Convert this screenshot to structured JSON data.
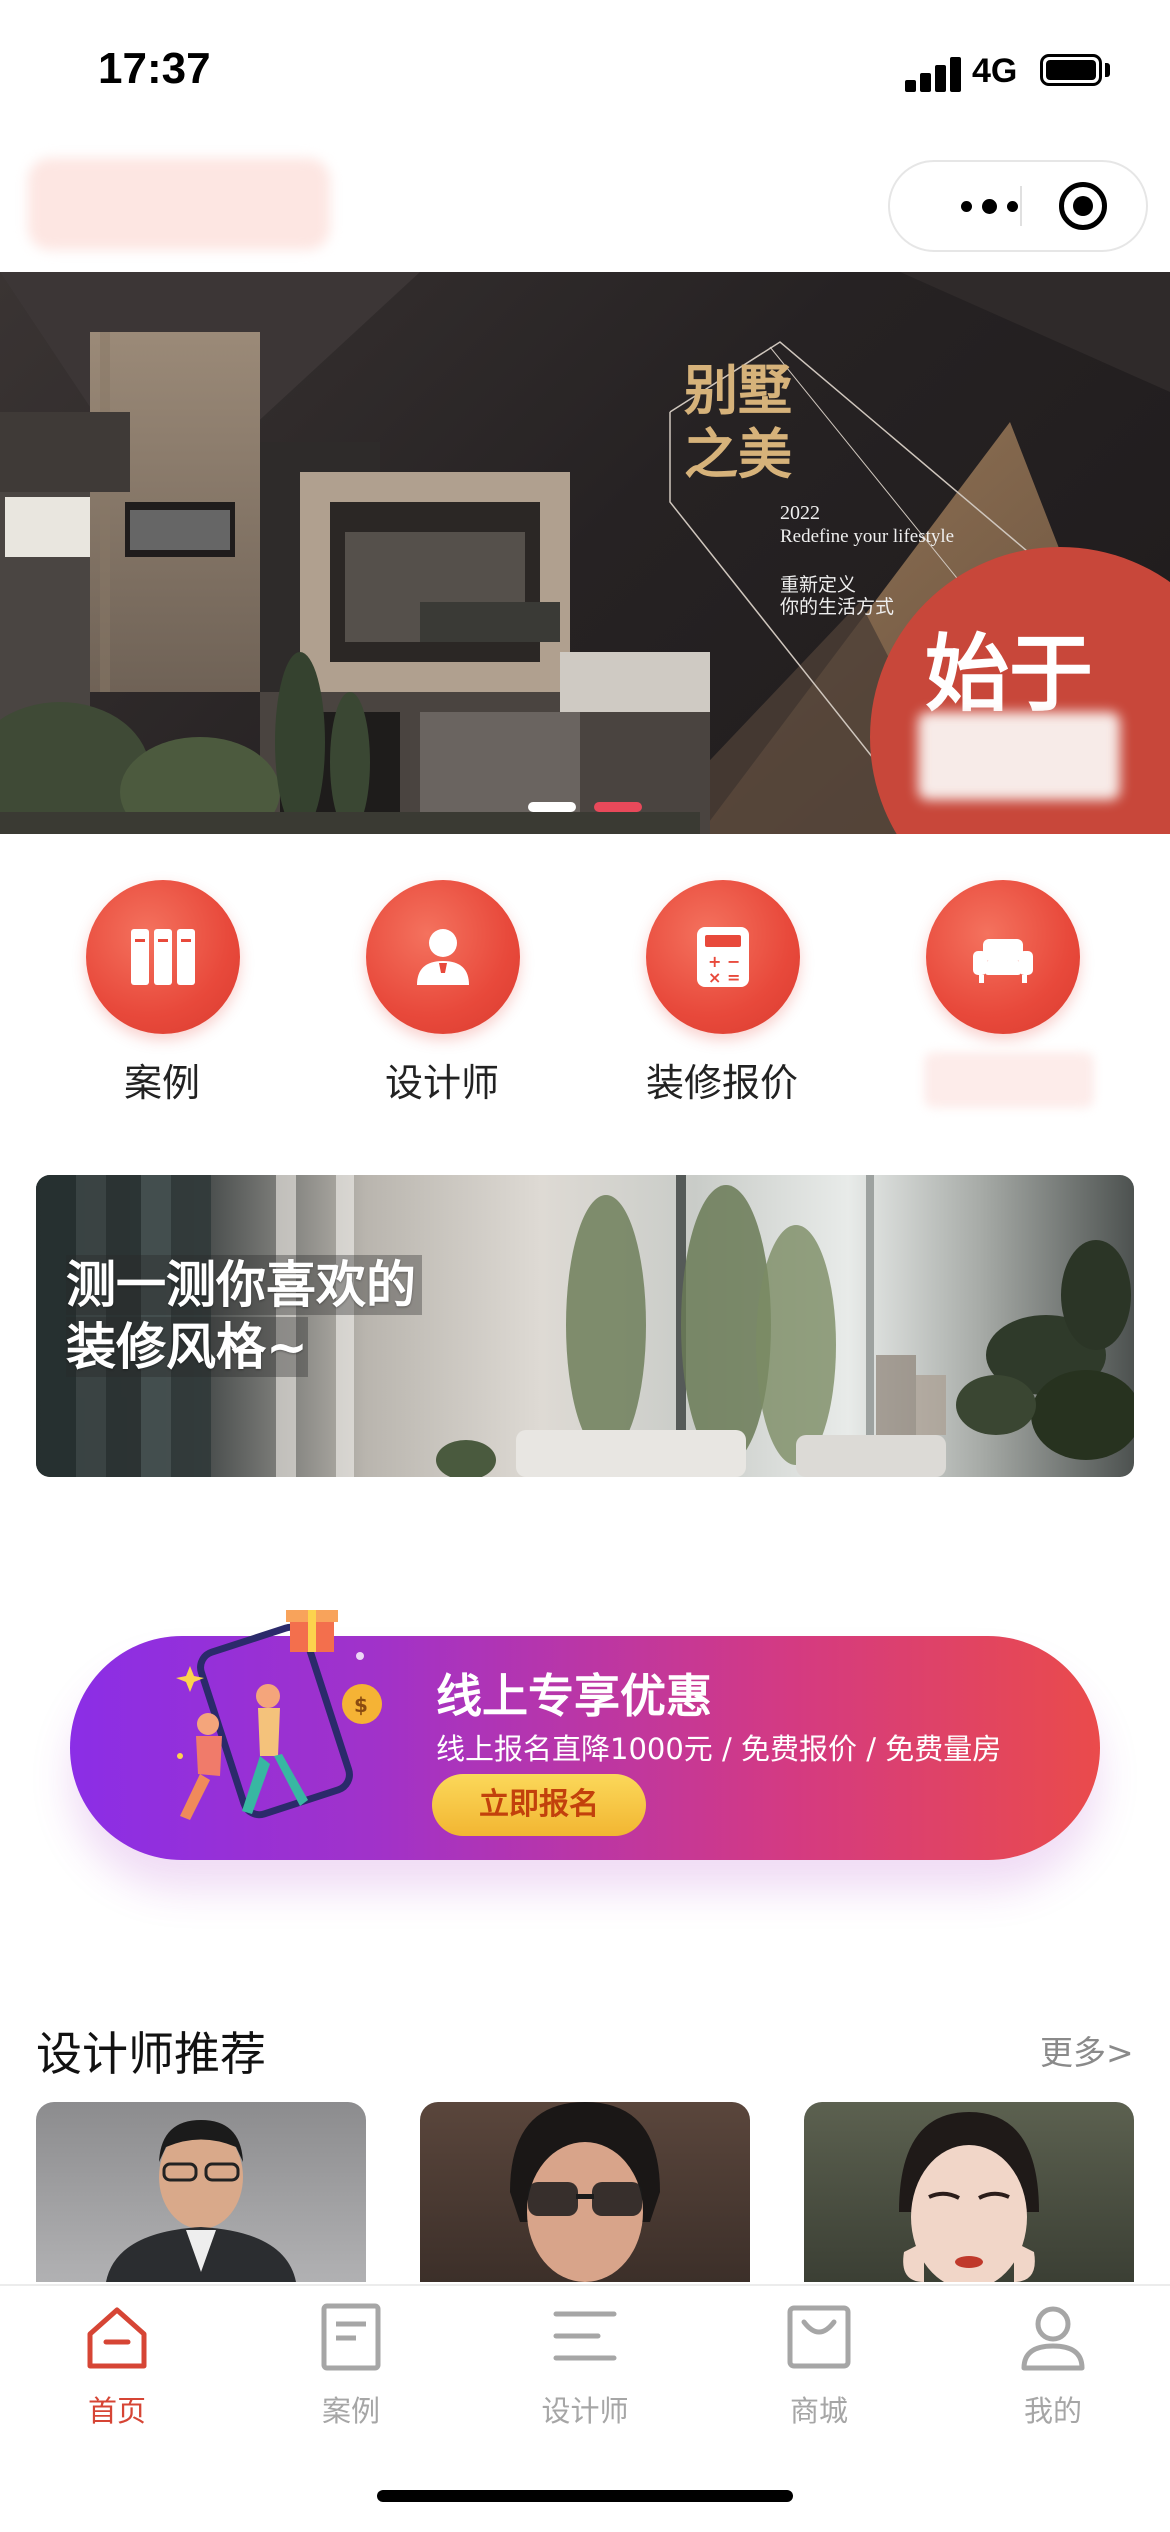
{
  "status_bar": {
    "time": "17:37",
    "network": "4G"
  },
  "hero": {
    "title": "别墅\n之美",
    "year": "2022",
    "slogan_en": "Redefine your lifestyle",
    "slogan_cn_1": "重新定义",
    "slogan_cn_2": "你的生活方式",
    "begin_text": "始于",
    "pager": {
      "count": 2,
      "active_index": 1
    }
  },
  "quick_nav": [
    {
      "label": "案例",
      "icon": "case-books-icon"
    },
    {
      "label": "设计师",
      "icon": "designer-person-icon"
    },
    {
      "label": "装修报价",
      "icon": "calculator-icon"
    },
    {
      "label": "",
      "icon": "sofa-icon"
    }
  ],
  "quiz_banner": {
    "line1": "测一测你喜欢的",
    "line2": "装修风格~"
  },
  "promo": {
    "title": "线上专享优惠",
    "subtitle": "线上报名直降1000元 / 免费报价 / 免费量房",
    "button": "立即报名"
  },
  "designers": {
    "title": "设计师推荐",
    "more": "更多>",
    "cards": [
      {
        "name": "designer-photo-1"
      },
      {
        "name": "designer-photo-2"
      },
      {
        "name": "designer-photo-3"
      }
    ]
  },
  "tabbar": [
    {
      "label": "首页",
      "icon": "home-icon",
      "active": true
    },
    {
      "label": "案例",
      "icon": "document-icon",
      "active": false
    },
    {
      "label": "设计师",
      "icon": "menu-lines-icon",
      "active": false
    },
    {
      "label": "商城",
      "icon": "shopping-bag-icon",
      "active": false
    },
    {
      "label": "我的",
      "icon": "user-icon",
      "active": false
    }
  ],
  "colors": {
    "accent": "#e8493b",
    "tab_active": "#d64535",
    "tab_inactive": "#a6a6a6",
    "pager_active": "#e8495a",
    "pager_inactive": "#ffffff",
    "hero_gold": "#d6b27a"
  }
}
